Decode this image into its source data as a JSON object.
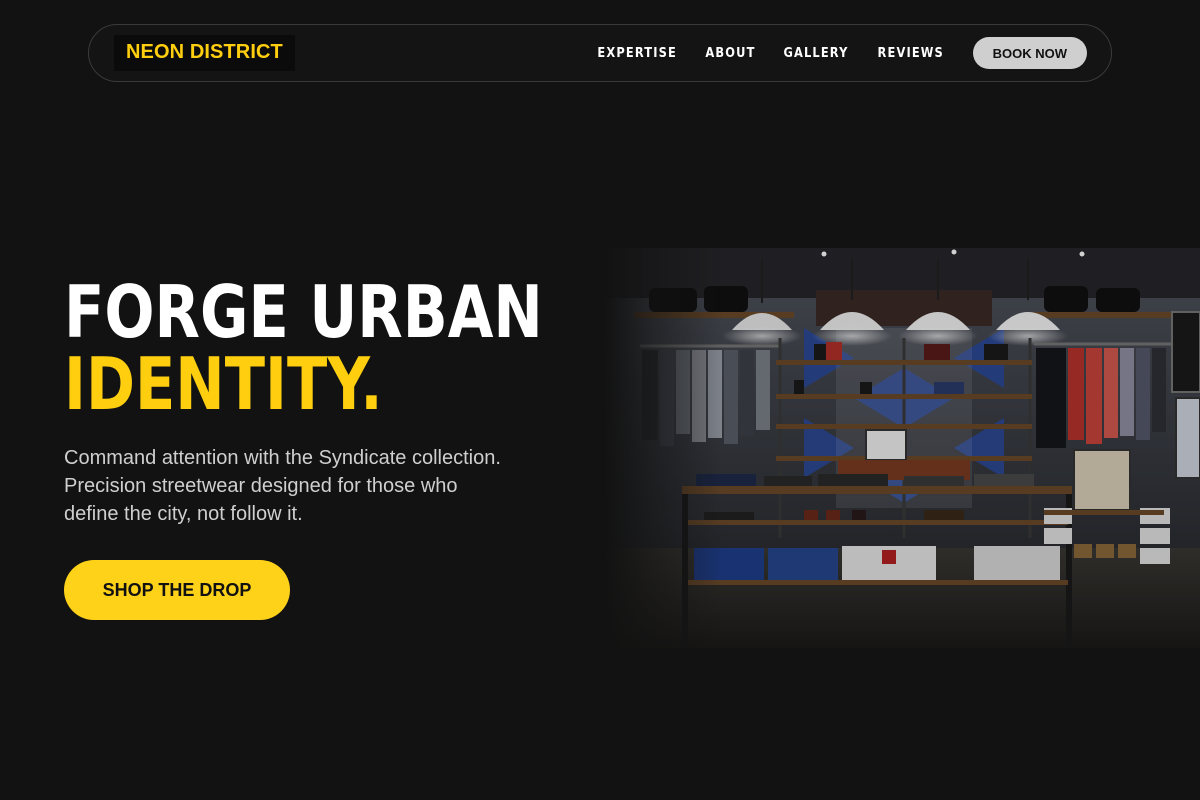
{
  "nav": {
    "brand": "NEON DISTRICT",
    "links": [
      "EXPERTISE",
      "ABOUT",
      "GALLERY",
      "REVIEWS"
    ],
    "cta_label": "BOOK NOW"
  },
  "hero": {
    "title_line1": "FORGE URBAN",
    "title_line2": "IDENTITY.",
    "description": "Command attention with the Syndicate collection. Precision streetwear designed for those who define the city, not follow it.",
    "cta_label": "SHOP THE DROP"
  },
  "colors": {
    "background": "#121212",
    "accent": "#ffcf0f",
    "text": "#ffffff",
    "muted_text": "#cfcfcf"
  }
}
